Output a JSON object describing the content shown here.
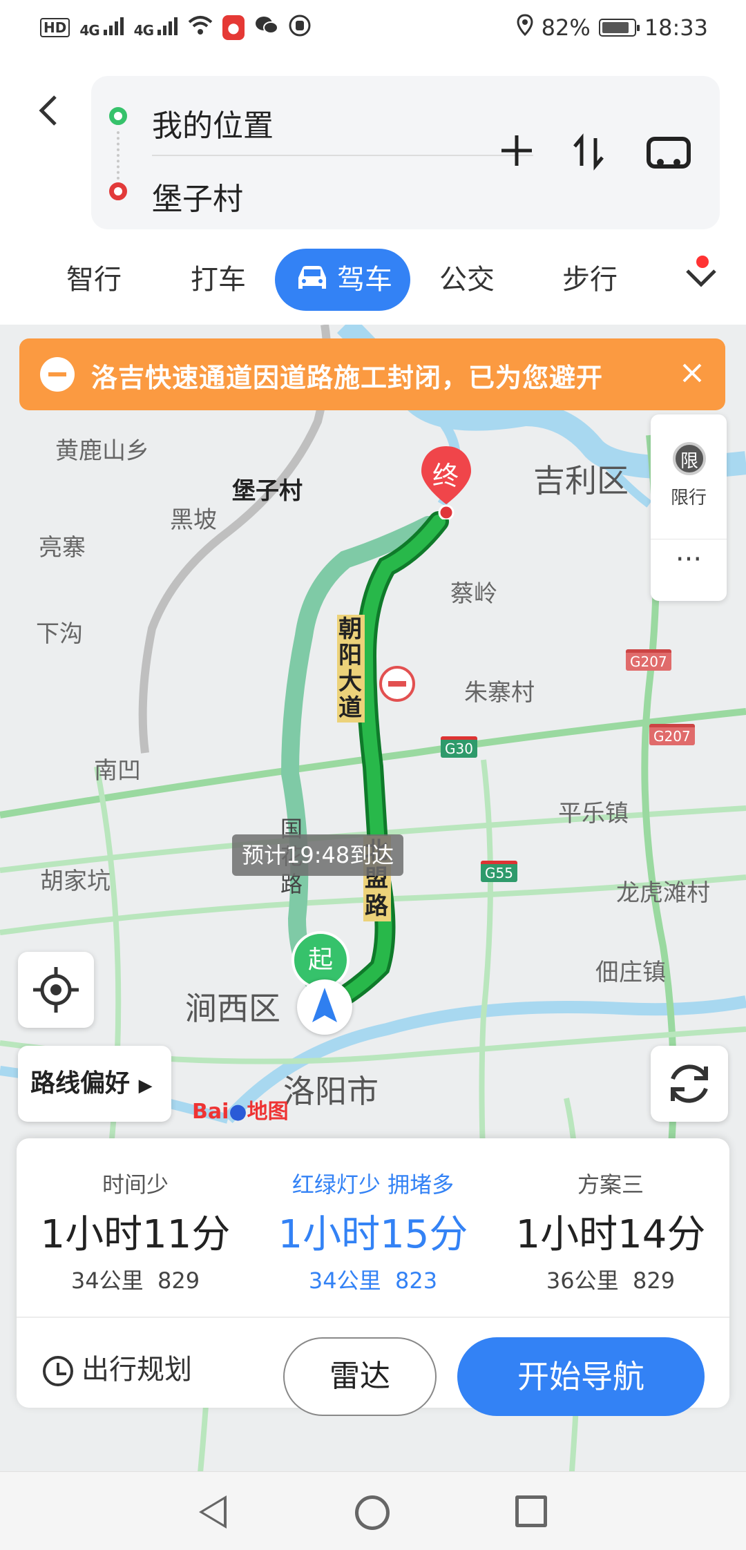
{
  "status_bar": {
    "hd": "HD",
    "net1": "4G",
    "net2": "4G",
    "battery_percent": "82%",
    "time": "18:33"
  },
  "header": {
    "start": "我的位置",
    "end": "堡子村"
  },
  "tabs": [
    {
      "label": "智行"
    },
    {
      "label": "打车"
    },
    {
      "label": "驾车"
    },
    {
      "label": "公交"
    },
    {
      "label": "步行"
    }
  ],
  "notice": {
    "text": "洛吉快速通道因道路施工封闭，已为您避开"
  },
  "side_panel": {
    "xianxing_icon": "限",
    "xianxing_label": "限行",
    "more": "···"
  },
  "map": {
    "places": [
      "黄鹿山乡",
      "堡子村",
      "黑坡",
      "亮寨",
      "下沟",
      "吉利区",
      "蔡岭",
      "朱寨村",
      "南凹",
      "平乐镇",
      "胡家坑",
      "龙虎滩村",
      "佃庄镇",
      "涧西区",
      "洛阳市"
    ],
    "shields": [
      "G207",
      "G207",
      "G30",
      "G55"
    ],
    "road_labels": [
      "朝阳大道",
      "北盟路",
      "国花路"
    ],
    "end_marker": "终",
    "start_marker": "起",
    "eta": "预计19:48到达",
    "baidu_logo_1": "Bai",
    "baidu_logo_2": "地图"
  },
  "buttons": {
    "route_pref": "路线偏好",
    "trip_plan": "出行规划",
    "radar": "雷达",
    "navigate": "开始导航"
  },
  "plans": [
    {
      "tag": "时间少",
      "time": "1小时11分",
      "distance": "34公里",
      "lights": "29",
      "selected": false
    },
    {
      "tag": "红绿灯少  拥堵多",
      "time": "1小时15分",
      "distance": "34公里",
      "lights": "23",
      "selected": true
    },
    {
      "tag": "方案三",
      "time": "1小时14分",
      "distance": "36公里",
      "lights": "29",
      "selected": false
    }
  ],
  "colors": {
    "accent": "#3382f5",
    "notice": "#fb9a41",
    "route_main": "#1d9e3a",
    "route_alt": "#7fcaa6"
  }
}
